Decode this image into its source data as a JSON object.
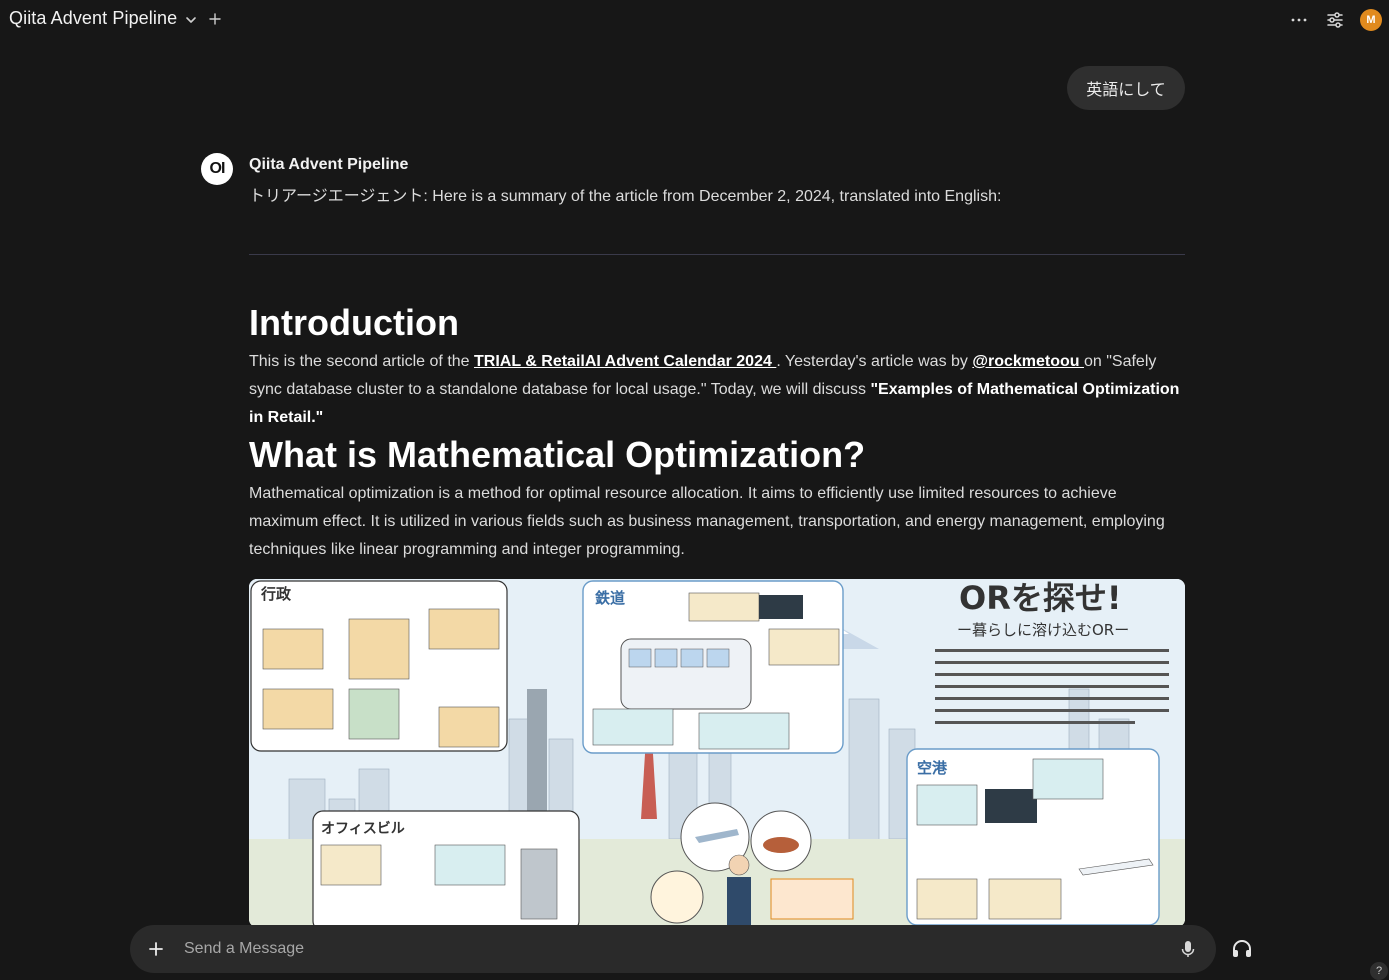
{
  "header": {
    "model_title": "Qiita Advent Pipeline",
    "user_initial": "M"
  },
  "user_message": "英語にして",
  "assistant": {
    "avatar_text": "OI",
    "name": "Qiita Advent Pipeline",
    "intro": "トリアージエージェント: Here is a summary of the article from December 2, 2024, translated into English:",
    "sections": [
      {
        "heading": "Introduction",
        "text_1": "This is the second article of the ",
        "link_1": "TRIAL & RetailAI Advent Calendar 2024 ",
        "text_2": ". Yesterday's article was by ",
        "link_2": "@rockmetoou ",
        "text_3": "on \"Safely sync database cluster to a standalone database for local usage.\" Today, we will discuss ",
        "bold": "\"Examples of Mathematical Optimization in Retail.\""
      },
      {
        "heading": "What is Mathematical Optimization?",
        "text": "Mathematical optimization is a method for optimal resource allocation. It aims to efficiently use limited resources to achieve maximum effect. It is utilized in various fields such as business management, transportation, and energy management, employing techniques like linear programming and integer programming."
      }
    ],
    "illustration": {
      "title": "ORを探せ!",
      "subtitle": "ー暮らしに溶け込むORー",
      "description": "オペレーションズ・リサーチ（Operations Research：OR）は「困っていること」（＝問題）を科学的に解決するための「問題解決学」です。問題の分析と解決のための計画立案やその実施、意思決定を助ける「実学」なのです。ORは問題のありかや応用の範囲を選びません。そのため、ORの研究を進める日本OR学会は経済学・経営学・理学・工学・農学・医学・芸術など文系理系を問わず、ありとあらゆる分野の会員から構成されています。",
      "panels": {
        "government": "行政",
        "railway": "鉄道",
        "airport": "空港",
        "office": "オフィスビル"
      }
    }
  },
  "composer": {
    "placeholder": "Send a Message"
  },
  "help_label": "?"
}
